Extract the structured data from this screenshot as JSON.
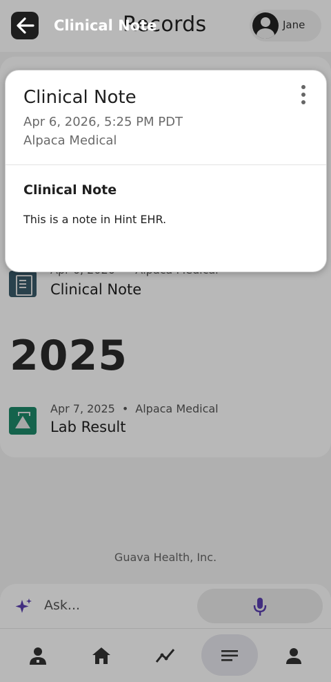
{
  "background": {
    "header": {
      "title": "Records",
      "user_name": "Jane"
    },
    "records": [
      {
        "date": "Apr 6, 2026",
        "provider": "Alpaca Medical",
        "title": "Clinical Note",
        "icon": "clipboard-icon"
      },
      {
        "date": "Apr 7, 2025",
        "provider": "Alpaca Medical",
        "title": "Lab Result",
        "icon": "flask-icon"
      }
    ],
    "year_heading": "2025",
    "separator": "•",
    "footer_company": "Guava Health, Inc.",
    "ask_placeholder": "Ask...",
    "nav_items": [
      "doctor-icon",
      "home-icon",
      "trends-icon",
      "records-icon",
      "profile-icon"
    ]
  },
  "topbar": {
    "title": "Clinical Note"
  },
  "modal": {
    "title": "Clinical Note",
    "date": "Apr 6, 2026, 5:25 PM PDT",
    "organization": "Alpaca Medical",
    "note_heading": "Clinical Note",
    "note_body": "This is a note in Hint EHR."
  },
  "colors": {
    "overlay": "#000000",
    "accent_purple": "#5a3fb0",
    "note_icon_bg": "#3a5a6a",
    "lab_icon_bg": "#1e8a6a"
  }
}
